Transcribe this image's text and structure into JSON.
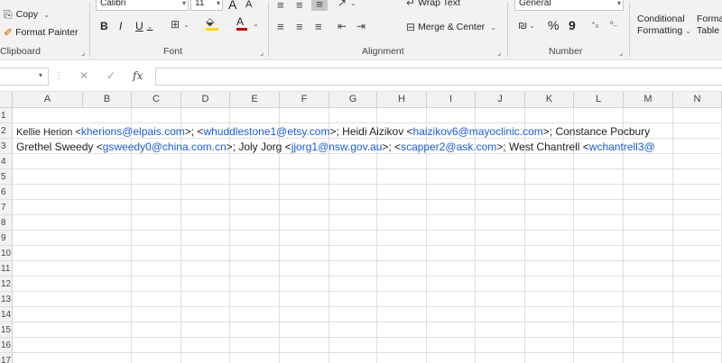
{
  "ribbon": {
    "clipboard": {
      "copy_label": "Copy",
      "format_painter_label": "Format Painter",
      "group_label": "Clipboard"
    },
    "font": {
      "font_name": "Calibri",
      "font_size": "11",
      "increase_size": "A",
      "decrease_size": "A",
      "bold": "B",
      "italic": "I",
      "underline": "U",
      "font_color": "A",
      "group_label": "Font"
    },
    "alignment": {
      "wrap_text_label": "Wrap Text",
      "merge_center_label": "Merge & Center",
      "group_label": "Alignment"
    },
    "number": {
      "format_value": "General",
      "percent": "%",
      "comma": "9",
      "group_label": "Number"
    },
    "styles": {
      "conditional_formatting_line1": "Conditional",
      "conditional_formatting_line2": "Formatting",
      "format_as_table_line1": "Forma",
      "format_as_table_line2": "Table"
    }
  },
  "formula_bar": {
    "name_box_value": "",
    "fx_label": "fx",
    "formula_value": ""
  },
  "grid": {
    "columns": [
      "A",
      "B",
      "C",
      "D",
      "E",
      "F",
      "G",
      "H",
      "I",
      "J",
      "K",
      "L",
      "M",
      "N"
    ],
    "rows": [
      "1",
      "2",
      "3",
      "4",
      "5",
      "6",
      "7",
      "8",
      "9",
      "10",
      "11",
      "12",
      "13",
      "14",
      "15",
      "16",
      "17"
    ],
    "row2": {
      "p1": "Kellie Herion <",
      "e1": "kherions@elpais.com",
      "p2": ">;  <",
      "e2": "whuddlestone1@etsy.com",
      "p3": ">; Heidi Aizikov <",
      "e3": "haizikov6@mayoclinic.com",
      "p4": ">; Constance Pocbury"
    },
    "row3": {
      "p1": "Grethel Sweedy <",
      "e1": "gsweedy0@china.com.cn",
      "p2": ">; Joly Jorg <",
      "e2": "jjorg1@nsw.gov.au",
      "p3": ">;  <",
      "e3": "scapper2@ask.com",
      "p4": ">; West Chantrell <",
      "e4": "wchantrell3@"
    }
  },
  "colors": {
    "link_blue": "#1a5bd6",
    "ribbon_bg": "#f3f2f1",
    "gridline": "#e1dfdd",
    "font_color_bar": "#c00000",
    "fill_color_bar": "#ffd700"
  }
}
